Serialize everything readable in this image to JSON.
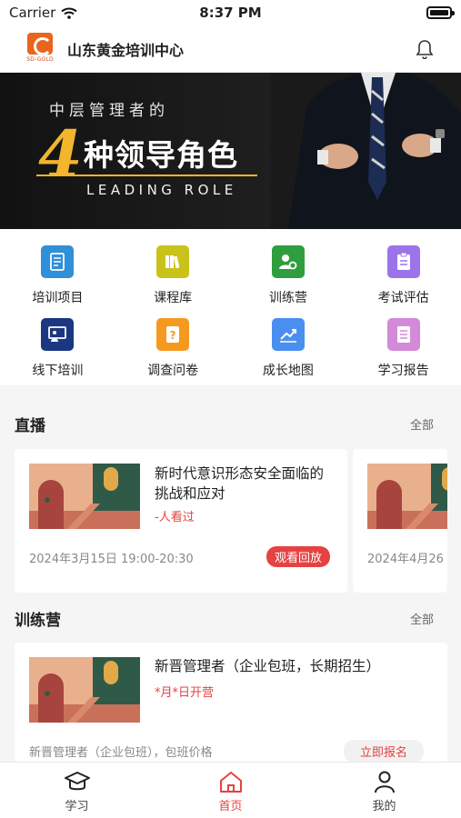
{
  "status_bar": {
    "carrier": "Carrier",
    "time": "8:37 PM"
  },
  "header": {
    "logo_text": "SD-GOLD",
    "title": "山东黄金培训中心",
    "bell_icon": "bell-icon"
  },
  "banner": {
    "subtitle": "中层管理者的",
    "number": "4",
    "main_title": "种领导角色",
    "english": "LEADING ROLE",
    "accent_color": "#f2b52c"
  },
  "grid": [
    {
      "label": "培训项目",
      "icon": "document-icon",
      "color": "#2f8fd8"
    },
    {
      "label": "课程库",
      "icon": "books-icon",
      "color": "#c9c21a"
    },
    {
      "label": "训练营",
      "icon": "users-gear-icon",
      "color": "#2e9e3e"
    },
    {
      "label": "考试评估",
      "icon": "clipboard-icon",
      "color": "#9a74e8"
    },
    {
      "label": "线下培训",
      "icon": "classroom-icon",
      "color": "#1a3780"
    },
    {
      "label": "调查问卷",
      "icon": "questionnaire-icon",
      "color": "#f59a1f"
    },
    {
      "label": "成长地图",
      "icon": "trend-chart-icon",
      "color": "#4a8ff0"
    },
    {
      "label": "学习报告",
      "icon": "report-icon",
      "color": "#d38ad8"
    }
  ],
  "live": {
    "title": "直播",
    "more": "全部",
    "cards": [
      {
        "title": "新时代意识形态安全面临的挑战和应对",
        "viewers": "-人看过",
        "date": "2024年3月15日 19:00-20:30",
        "action": "观看回放"
      },
      {
        "title": "",
        "viewers": "",
        "date": "2024年4月26",
        "action": ""
      }
    ]
  },
  "camp": {
    "title": "训练营",
    "more": "全部",
    "card": {
      "title": "新晋管理者（企业包班，长期招生）",
      "schedule": "*月*日开营",
      "desc": "新晋管理者（企业包班），包班价格",
      "action": "立即报名"
    }
  },
  "tabbar": [
    {
      "label": "学习",
      "icon": "graduation-cap-icon",
      "active": false
    },
    {
      "label": "首页",
      "icon": "home-icon",
      "active": true
    },
    {
      "label": "我的",
      "icon": "person-icon",
      "active": false
    }
  ],
  "colors": {
    "brand_red": "#e54242",
    "brand_orange": "#e8651d"
  }
}
